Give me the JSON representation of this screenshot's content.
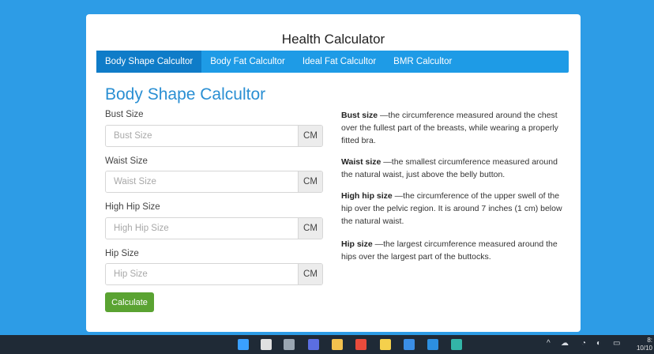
{
  "app": {
    "title": "Health Calculator"
  },
  "tabs": [
    {
      "label": "Body Shape Calcultor",
      "active": true
    },
    {
      "label": "Body Fat Calcultor",
      "active": false
    },
    {
      "label": "Ideal Fat Calcultor",
      "active": false
    },
    {
      "label": "BMR Calcultor",
      "active": false
    }
  ],
  "section": {
    "title": "Body Shape Calcultor"
  },
  "fields": [
    {
      "label": "Bust Size",
      "placeholder": "Bust Size",
      "value": "",
      "unit": "CM"
    },
    {
      "label": "Waist Size",
      "placeholder": "Waist Size",
      "value": "",
      "unit": "CM"
    },
    {
      "label": "High Hip Size",
      "placeholder": "High Hip Size",
      "value": "",
      "unit": "CM"
    },
    {
      "label": "Hip Size",
      "placeholder": "Hip Size",
      "value": "",
      "unit": "CM"
    }
  ],
  "calculate_button": {
    "label": "Calculate"
  },
  "descriptions": [
    {
      "term": "Bust size",
      "text": " —the circumference measured around the chest over the fullest part of the breasts, while wearing a properly fitted bra."
    },
    {
      "term": "Waist size",
      "text": " —the smallest circumference measured around the natural waist, just above the belly button."
    },
    {
      "term": "High hip size",
      "text": " —the circumference of the upper swell of the hip over the pelvic region. It is around 7 inches (1 cm) below the natural waist."
    },
    {
      "term": "Hip size",
      "text": " —the largest circumference measured around the hips over the largest part of the buttocks."
    }
  ],
  "taskbar": {
    "icons": [
      "windows-start",
      "search",
      "task-view",
      "chat",
      "file-explorer",
      "chrome",
      "store",
      "notepad",
      "vscode",
      "edge"
    ],
    "icon_colors": [
      "#3aa0ff",
      "#e0e0e0",
      "#9aa6b2",
      "#5b6ee1",
      "#f2c14e",
      "#e94b3c",
      "#f5d04c",
      "#3a8ee6",
      "#2c8fe0",
      "#33b5a8"
    ],
    "clock_time": "8:",
    "clock_date": "10/10"
  },
  "colors": {
    "background": "#2d9ce6",
    "tab_bar": "#1e9be6",
    "active_tab": "#0f7cc8",
    "section_title": "#2a8fd3",
    "button": "#5aa332"
  }
}
